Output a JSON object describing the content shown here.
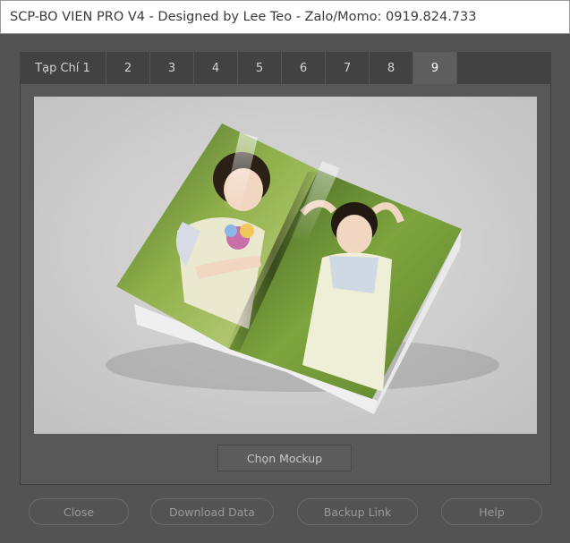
{
  "window": {
    "title": "SCP-BO VIEN PRO V4 - Designed by Lee Teo - Zalo/Momo: 0919.824.733"
  },
  "tabs": [
    {
      "label": "Tạp Chí 1",
      "active": false
    },
    {
      "label": "2",
      "active": false
    },
    {
      "label": "3",
      "active": false
    },
    {
      "label": "4",
      "active": false
    },
    {
      "label": "5",
      "active": false
    },
    {
      "label": "6",
      "active": false
    },
    {
      "label": "7",
      "active": false
    },
    {
      "label": "8",
      "active": false
    },
    {
      "label": "9",
      "active": true
    }
  ],
  "panel": {
    "choose_mockup_label": "Chọn Mockup"
  },
  "footer": {
    "close_label": "Close",
    "download_label": "Download Data",
    "backup_label": "Backup Link",
    "help_label": "Help"
  },
  "colors": {
    "window_bg": "#535353",
    "tab_active_bg": "#5e5e5e",
    "tab_bar_bg": "#424242",
    "preview_bg": "#d0d0d0"
  }
}
